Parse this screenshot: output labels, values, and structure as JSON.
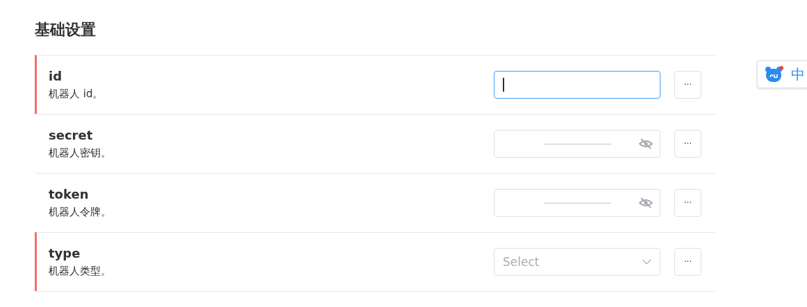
{
  "section": {
    "title": "基础设置"
  },
  "settings": [
    {
      "name": "id",
      "description": "机器人 id。",
      "required": true,
      "kind": "text",
      "focused": true
    },
    {
      "name": "secret",
      "description": "机器人密钥。",
      "required": false,
      "kind": "password",
      "focused": false
    },
    {
      "name": "token",
      "description": "机器人令牌。",
      "required": false,
      "kind": "password",
      "focused": false
    },
    {
      "name": "type",
      "description": "机器人类型。",
      "required": true,
      "kind": "select",
      "focused": false,
      "placeholder": "Select"
    }
  ],
  "more_button": {
    "label": "···"
  },
  "ime": {
    "label": "中"
  }
}
